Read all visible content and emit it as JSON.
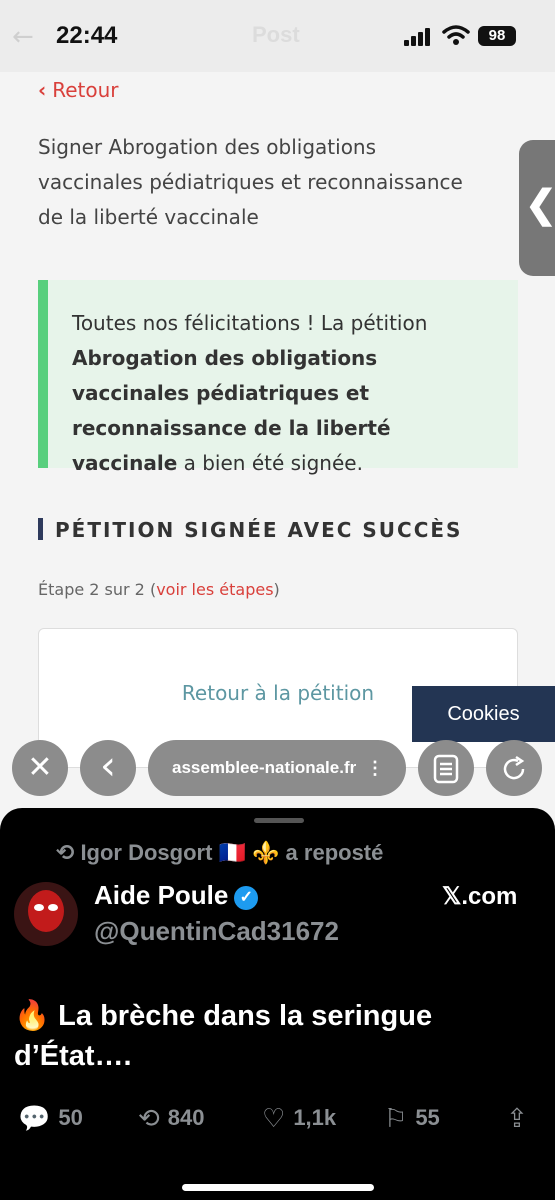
{
  "status_bar": {
    "time": "22:44",
    "ghost_title": "Post",
    "battery": "98"
  },
  "page": {
    "back_label": "Retour",
    "title": "Signer Abrogation des obligations vaccinales pédiatriques et reconnaissance de la liberté vaccinale",
    "success": {
      "prefix": "Toutes nos félicitations ! La pétition",
      "petition_name": "Abrogation des obligations vaccinales pédiatriques et reconnaissance de la liberté vaccinale",
      "suffix": "a bien été signée."
    },
    "section_title": "PÉTITION SIGNÉE AVEC SUCCÈS",
    "step_text": "Étape 2 sur 2 (",
    "step_link": "voir les étapes",
    "step_close": ")",
    "card_link": "Retour à la pétition",
    "cookies_label": "Cookies",
    "side_tab_glyph": "❮"
  },
  "toolbar": {
    "close_glyph": "✕",
    "back_glyph": "‹",
    "url": "assemblee-nationale.fr",
    "url_more": "⋮",
    "reader_icon": "reader-icon",
    "reload_icon": "reload-icon"
  },
  "tweet": {
    "repost_line": "Igor Dosgort 🇫🇷 ⚜️ a reposté",
    "author_name": "Aide Poule",
    "handle": "@QuentinCad31672",
    "source": "𝕏.com",
    "text": "🔥 La brèche dans la seringue d’État….",
    "replies": "50",
    "reposts": "840",
    "likes": "1,1k",
    "bookmarks": "55"
  },
  "colors": {
    "accent_red": "#d9403b",
    "success_green": "#58cf7d",
    "navy": "#233553",
    "link_teal": "#5d97a2",
    "verified_blue": "#1d9bf0"
  }
}
